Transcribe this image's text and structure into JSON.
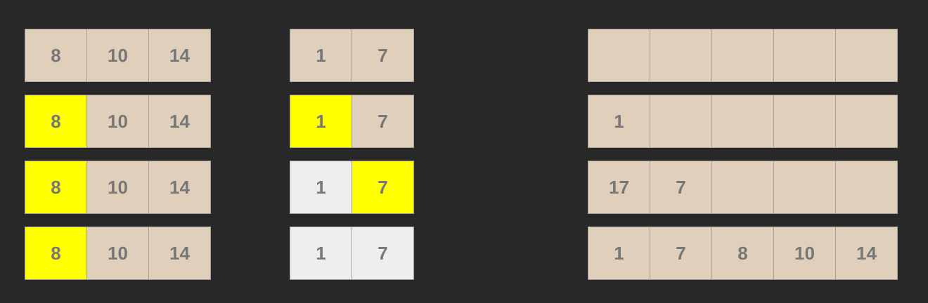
{
  "colors": {
    "background": "#282828",
    "cell": "#dfcfbb",
    "highlight": "#ffff00",
    "consumed": "#eeeeee",
    "text": "#777777",
    "border": "#a39e98"
  },
  "steps": [
    {
      "left": [
        {
          "v": "8",
          "s": "normal"
        },
        {
          "v": "10",
          "s": "normal"
        },
        {
          "v": "14",
          "s": "normal"
        }
      ],
      "right": [
        {
          "v": "1",
          "s": "normal"
        },
        {
          "v": "7",
          "s": "normal"
        }
      ],
      "merged": [
        {
          "v": "",
          "s": "normal"
        },
        {
          "v": "",
          "s": "normal"
        },
        {
          "v": "",
          "s": "normal"
        },
        {
          "v": "",
          "s": "normal"
        },
        {
          "v": "",
          "s": "normal"
        }
      ]
    },
    {
      "left": [
        {
          "v": "8",
          "s": "hl"
        },
        {
          "v": "10",
          "s": "normal"
        },
        {
          "v": "14",
          "s": "normal"
        }
      ],
      "right": [
        {
          "v": "1",
          "s": "hl"
        },
        {
          "v": "7",
          "s": "normal"
        }
      ],
      "merged": [
        {
          "v": "1",
          "s": "normal"
        },
        {
          "v": "",
          "s": "normal"
        },
        {
          "v": "",
          "s": "normal"
        },
        {
          "v": "",
          "s": "normal"
        },
        {
          "v": "",
          "s": "normal"
        }
      ]
    },
    {
      "left": [
        {
          "v": "8",
          "s": "hl"
        },
        {
          "v": "10",
          "s": "normal"
        },
        {
          "v": "14",
          "s": "normal"
        }
      ],
      "right": [
        {
          "v": "1",
          "s": "done"
        },
        {
          "v": "7",
          "s": "hl"
        }
      ],
      "merged": [
        {
          "v": "17",
          "s": "normal"
        },
        {
          "v": "7",
          "s": "normal"
        },
        {
          "v": "",
          "s": "normal"
        },
        {
          "v": "",
          "s": "normal"
        },
        {
          "v": "",
          "s": "normal"
        }
      ]
    },
    {
      "left": [
        {
          "v": "8",
          "s": "hl"
        },
        {
          "v": "10",
          "s": "normal"
        },
        {
          "v": "14",
          "s": "normal"
        }
      ],
      "right": [
        {
          "v": "1",
          "s": "done"
        },
        {
          "v": "7",
          "s": "done"
        }
      ],
      "merged": [
        {
          "v": "1",
          "s": "normal"
        },
        {
          "v": "7",
          "s": "normal"
        },
        {
          "v": "8",
          "s": "normal"
        },
        {
          "v": "10",
          "s": "normal"
        },
        {
          "v": "14",
          "s": "normal"
        }
      ]
    }
  ]
}
